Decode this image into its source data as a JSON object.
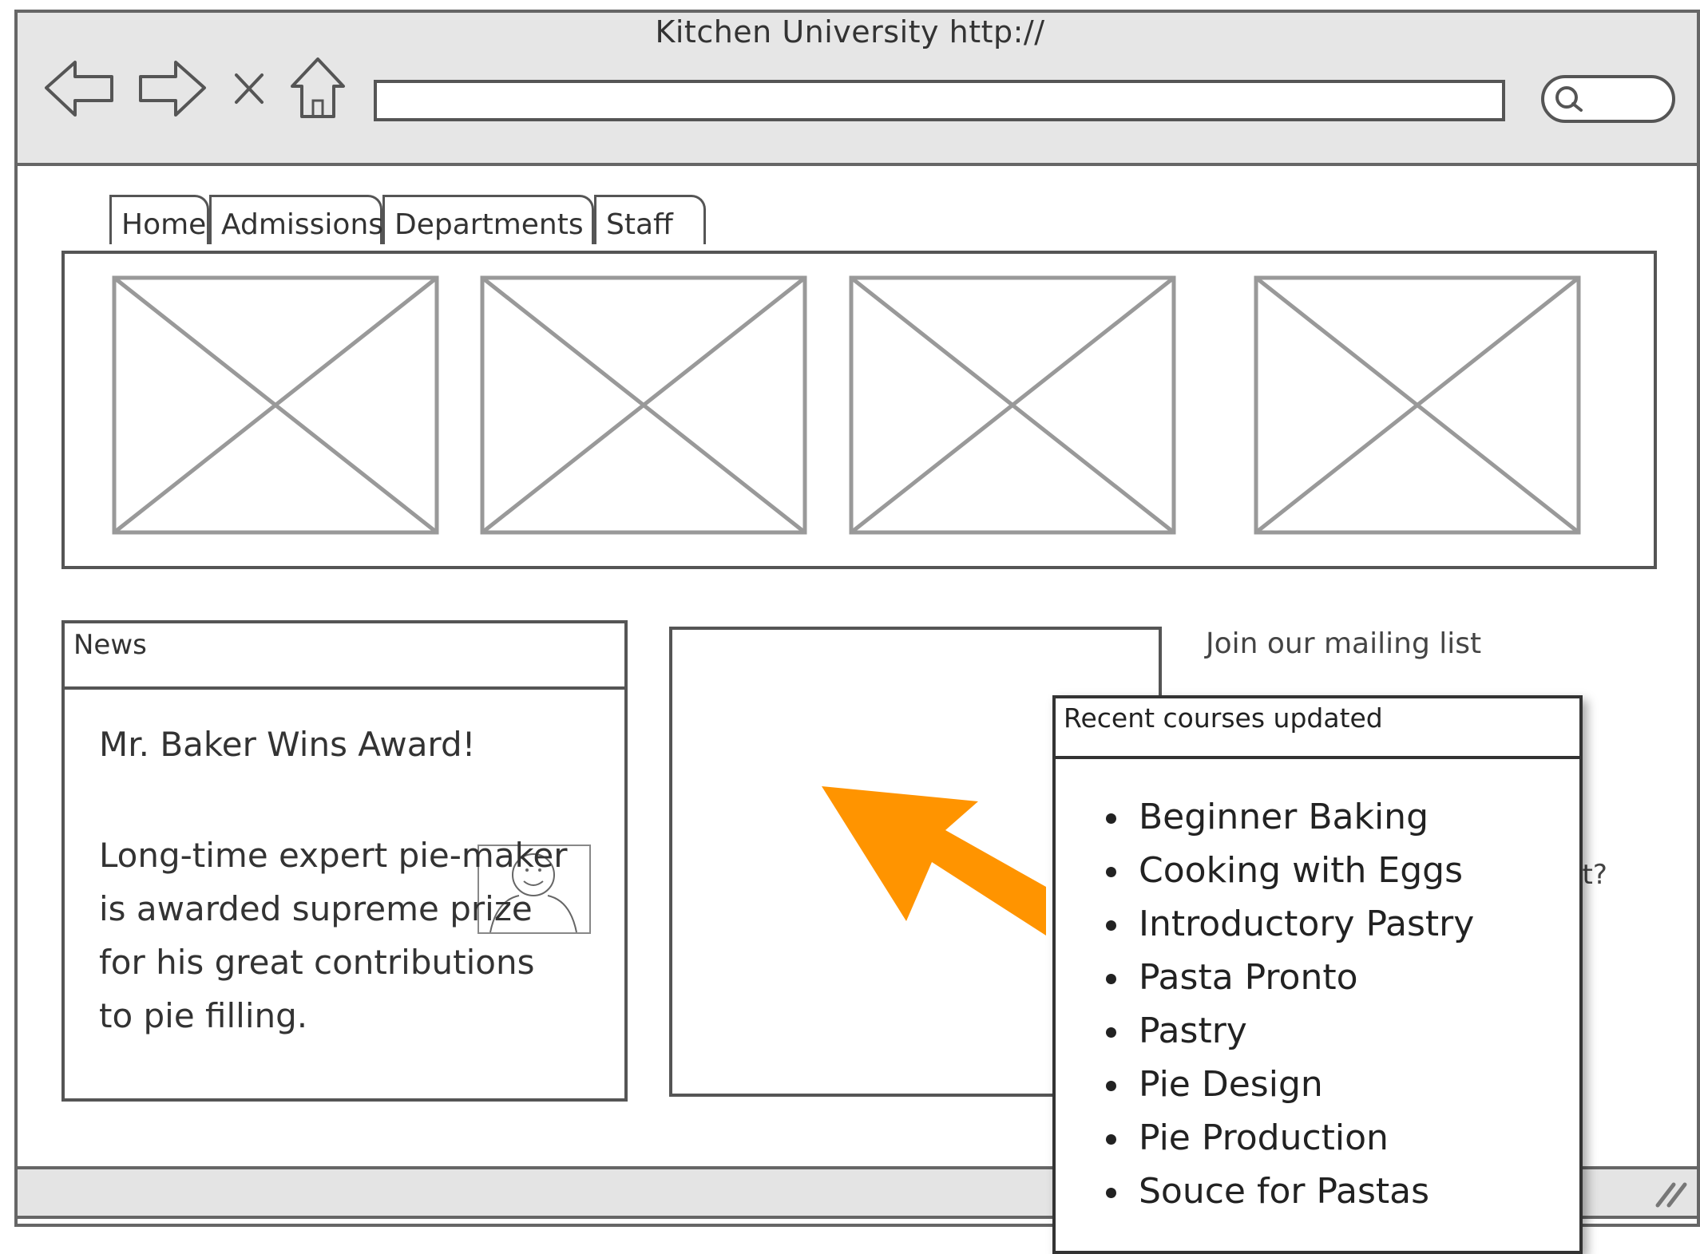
{
  "window": {
    "title": "Kitchen University http://"
  },
  "address_bar": {
    "value": ""
  },
  "tabs": [
    {
      "label": "Home"
    },
    {
      "label": "Admissions"
    },
    {
      "label": "Departments"
    },
    {
      "label": "Staff"
    }
  ],
  "hero": {
    "image_count": 4
  },
  "news": {
    "header": "News",
    "headline": "Mr. Baker Wins Award!",
    "body": "Long-time expert pie-maker is awarded supreme prize for his great contributions to pie filling."
  },
  "sidebar": {
    "mailing_list_link": "Join our mailing list",
    "partial_text": "nt?"
  },
  "popup": {
    "title": "Recent courses updated",
    "courses": [
      "Beginner Baking",
      "Cooking with Eggs",
      "Introductory Pastry",
      "Pasta Pronto",
      "Pastry",
      "Pie Design",
      "Pie Production",
      "Souce for Pastas"
    ]
  },
  "colors": {
    "arrow": "#FF9400",
    "chrome": "#E6E6E6",
    "stroke": "#555555"
  }
}
